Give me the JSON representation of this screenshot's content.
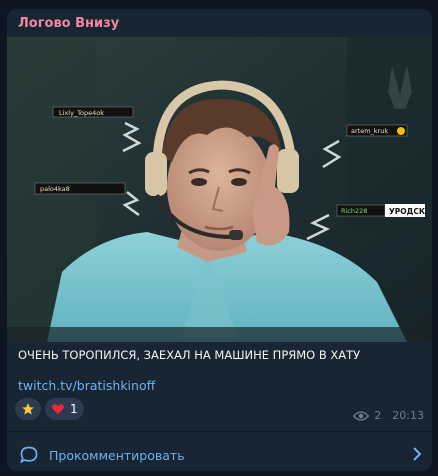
{
  "post": {
    "channel_name": "Логово Внизу",
    "caption": "ОЧЕНЬ ТОРОПИЛСЯ, ЗАЕХАЛ НА МАШИНЕ ПРЯМО В ХАТУ",
    "link": "twitch.tv/bratishkinoff",
    "image": {
      "chat_tags": [
        "Lixly_Tope4ok",
        "artem_kruk",
        "palo4ka8",
        "Rich228"
      ],
      "chat_label": "УРОДСК"
    },
    "reactions": [
      {
        "icon": "star-icon",
        "count": ""
      },
      {
        "icon": "heart-icon",
        "count": "1"
      }
    ],
    "views": "2",
    "time": "20:13"
  },
  "comment_bar": {
    "label": "Прокомментировать"
  },
  "colors": {
    "background": "#0e1621",
    "bubble": "#182533",
    "channel_name": "#f186a3",
    "link": "#6ab3f3",
    "meta": "#6d7f8f"
  }
}
